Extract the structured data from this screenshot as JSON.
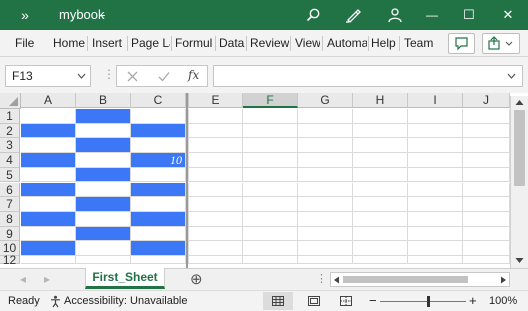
{
  "title_bar": {
    "expand_glyph": "»",
    "doc_title": "mybook",
    "title_suffix": "-",
    "minimize": "—",
    "maximize": "☐",
    "close": "✕"
  },
  "ribbon": {
    "tabs": [
      "File",
      "Home",
      "Insert",
      "Page La",
      "Formul",
      "Data",
      "Review",
      "View",
      "Automa",
      "Help",
      "Team"
    ]
  },
  "formula_bar": {
    "name_box": "F13",
    "fx_label": "fx",
    "formula": ""
  },
  "grid": {
    "columns": [
      "A",
      "B",
      "C",
      "",
      "E",
      "F",
      "G",
      "H",
      "I",
      "J"
    ],
    "rows": [
      "1",
      "2",
      "3",
      "4",
      "5",
      "6",
      "7",
      "8",
      "9",
      "10",
      "12"
    ],
    "cell_C4": "10",
    "fill_color": "#3c78f5",
    "selected_column": "F"
  },
  "sheets": {
    "active_tab": "First_Sheet",
    "add_glyph": "⊕"
  },
  "status": {
    "ready": "Ready",
    "accessibility": "Accessibility: Unavailable",
    "zoom_minus": "−",
    "zoom_plus": "+",
    "zoom": "100%",
    "zoom_level": 0.56
  }
}
